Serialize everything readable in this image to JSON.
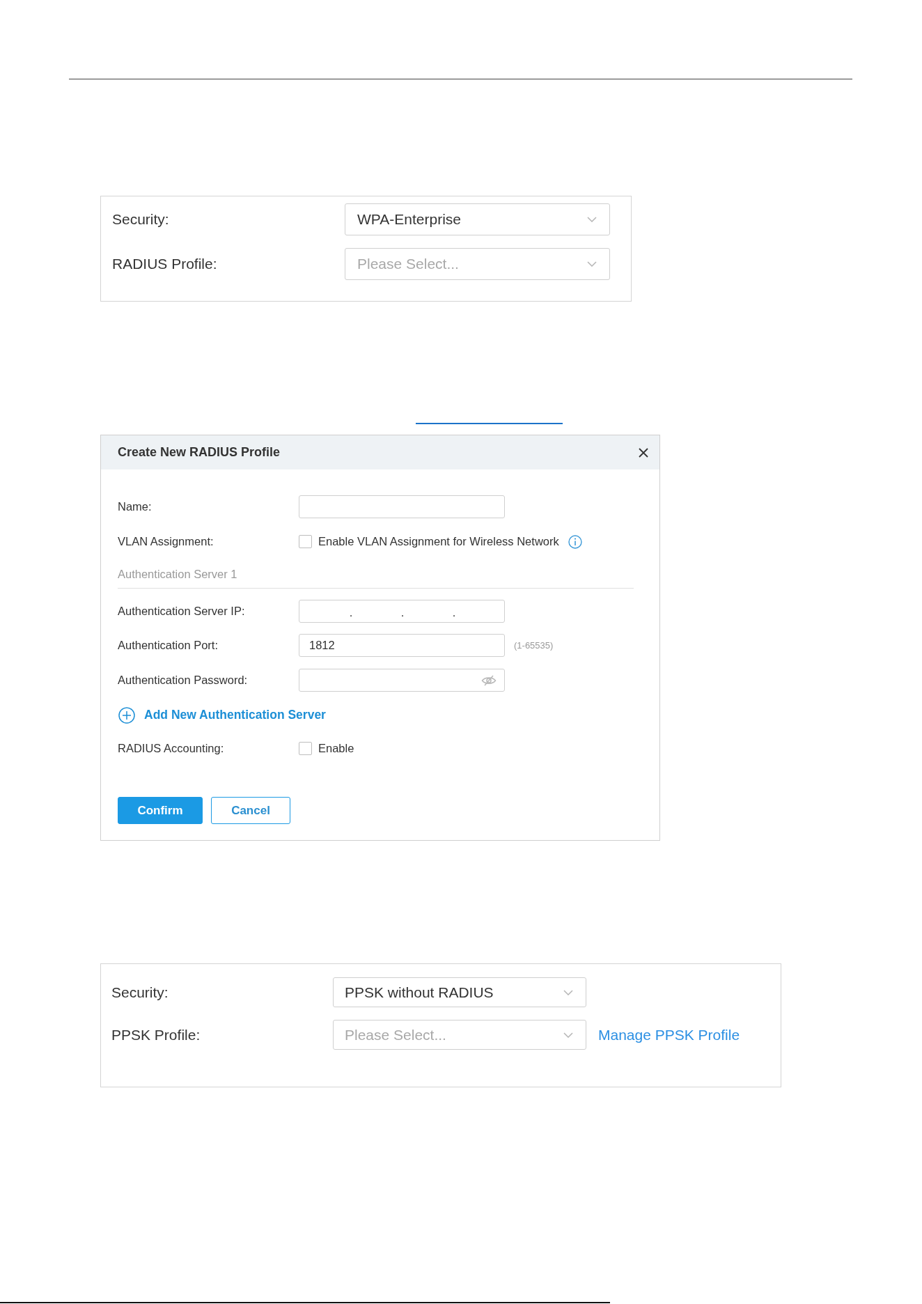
{
  "wpa_enterprise_panel": {
    "fields": [
      {
        "label": "Security:",
        "value": "WPA-Enterprise"
      },
      {
        "label": "RADIUS Profile:",
        "placeholder": "Please Select..."
      }
    ]
  },
  "radius_dialog": {
    "title": "Create New RADIUS Profile",
    "rows": [
      {
        "kind": "text",
        "label": "Name:"
      },
      {
        "kind": "checkbox",
        "label": "VLAN Assignment:",
        "option": "Enable VLAN Assignment for Wireless Network",
        "checked": false,
        "info_icon": true
      },
      {
        "kind": "section",
        "label": "Authentication Server 1"
      },
      {
        "kind": "ip",
        "label": "Authentication Server IP:",
        "separators": [
          ".",
          ".",
          "."
        ]
      },
      {
        "kind": "text",
        "label": "Authentication Port:",
        "value": "1812",
        "hint": "(1-65535)"
      },
      {
        "kind": "password",
        "label": "Authentication Password:"
      },
      {
        "kind": "add",
        "label": "Add New Authentication Server"
      },
      {
        "kind": "checkbox",
        "label": "RADIUS Accounting:",
        "option": "Enable",
        "checked": false
      }
    ],
    "buttons": [
      {
        "kind": "primary",
        "label": "Confirm"
      },
      {
        "kind": "secondary",
        "label": "Cancel"
      }
    ]
  },
  "ppsk_panel": {
    "fields": [
      {
        "label": "Security:",
        "value": "PPSK without RADIUS"
      },
      {
        "label": "PPSK Profile:",
        "placeholder": "Please Select...",
        "link": "Manage PPSK Profile"
      }
    ]
  }
}
